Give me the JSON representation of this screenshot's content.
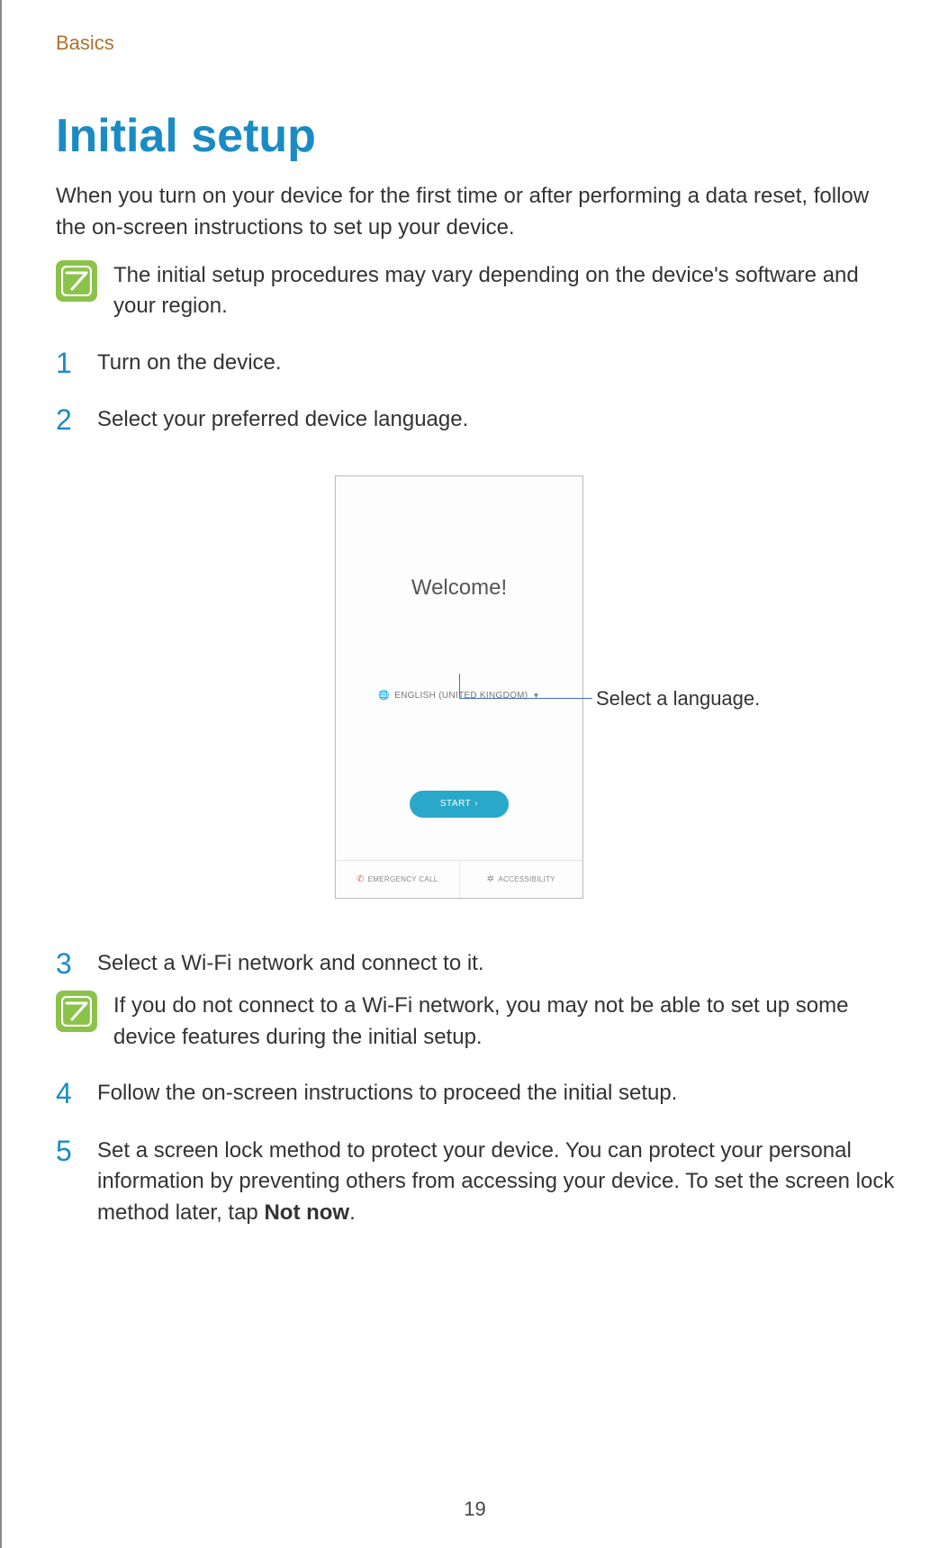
{
  "breadcrumb": "Basics",
  "title": "Initial setup",
  "intro": "When you turn on your device for the first time or after performing a data reset, follow the on-screen instructions to set up your device.",
  "note1": "The initial setup procedures may vary depending on the device's software and your region.",
  "steps": {
    "s1": {
      "num": "1",
      "text": "Turn on the device."
    },
    "s2": {
      "num": "2",
      "text": "Select your preferred device language."
    },
    "s3": {
      "num": "3",
      "text": "Select a Wi-Fi network and connect to it."
    },
    "s4": {
      "num": "4",
      "text": "Follow the on-screen instructions to proceed the initial setup."
    },
    "s5": {
      "num": "5",
      "text_a": "Set a screen lock method to protect your device. You can protect your personal information by preventing others from accessing your device. To set the screen lock method later, tap ",
      "text_b": "Not now",
      "text_c": "."
    }
  },
  "note2": "If you do not connect to a Wi-Fi network, you may not be able to set up some device features during the initial setup.",
  "phone": {
    "welcome": "Welcome!",
    "language": "ENGLISH (UNITED KINGDOM)",
    "start": "START",
    "emergency": "EMERGENCY CALL",
    "accessibility": "ACCESSIBILITY"
  },
  "callout": "Select a language.",
  "page_number": "19"
}
